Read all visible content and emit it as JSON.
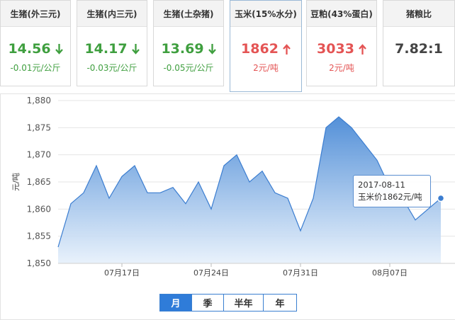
{
  "cards": [
    {
      "title": "生猪(外三元)",
      "price": "14.56",
      "direction": "down",
      "change": "-0.01元/公斤"
    },
    {
      "title": "生猪(内三元)",
      "price": "14.17",
      "direction": "down",
      "change": "-0.03元/公斤"
    },
    {
      "title": "生猪(土杂猪)",
      "price": "13.69",
      "direction": "down",
      "change": "-0.05元/公斤"
    },
    {
      "title": "玉米(15%水分)",
      "price": "1862",
      "direction": "up",
      "change": "2元/吨"
    },
    {
      "title": "豆粕(43%蛋白)",
      "price": "3033",
      "direction": "up",
      "change": "2元/吨"
    },
    {
      "title": "猪粮比",
      "price": "7.82:1",
      "direction": "none",
      "change": ""
    }
  ],
  "colors": {
    "down": "#3f9f3f",
    "up": "#e45454",
    "accent": "#2f7cd9",
    "area_top": "#4a8ad6",
    "area_bottom": "#e6f0fb"
  },
  "chart_data": {
    "type": "area",
    "ylabel": "元/吨",
    "ylim": [
      1850,
      1880
    ],
    "yticks": [
      1850,
      1855,
      1860,
      1865,
      1870,
      1875,
      1880
    ],
    "ytick_labels": [
      "1,850",
      "1,855",
      "1,860",
      "1,865",
      "1,870",
      "1,875",
      "1,880"
    ],
    "xticks": [
      {
        "date": "2017-07-17",
        "label": "07月17日"
      },
      {
        "date": "2017-07-24",
        "label": "07月24日"
      },
      {
        "date": "2017-07-31",
        "label": "07月31日"
      },
      {
        "date": "2017-08-07",
        "label": "08月07日"
      }
    ],
    "series": [
      {
        "name": "玉米价",
        "x": [
          "2017-07-12",
          "2017-07-13",
          "2017-07-14",
          "2017-07-15",
          "2017-07-16",
          "2017-07-17",
          "2017-07-18",
          "2017-07-19",
          "2017-07-20",
          "2017-07-21",
          "2017-07-22",
          "2017-07-23",
          "2017-07-24",
          "2017-07-25",
          "2017-07-26",
          "2017-07-27",
          "2017-07-28",
          "2017-07-29",
          "2017-07-30",
          "2017-07-31",
          "2017-08-01",
          "2017-08-02",
          "2017-08-03",
          "2017-08-04",
          "2017-08-05",
          "2017-08-06",
          "2017-08-07",
          "2017-08-08",
          "2017-08-09",
          "2017-08-10",
          "2017-08-11"
        ],
        "values": [
          1853,
          1861,
          1863,
          1868,
          1862,
          1866,
          1868,
          1863,
          1863,
          1864,
          1861,
          1865,
          1860,
          1868,
          1870,
          1865,
          1867,
          1863,
          1862,
          1856,
          1862,
          1875,
          1877,
          1875,
          1872,
          1869,
          1864,
          1862,
          1858,
          1860,
          1862
        ]
      }
    ]
  },
  "tooltip": {
    "date": "2017-08-11",
    "text": "玉米价1862元/吨"
  },
  "range_tabs": [
    {
      "label": "月",
      "active": true
    },
    {
      "label": "季",
      "active": false
    },
    {
      "label": "半年",
      "active": false
    },
    {
      "label": "年",
      "active": false
    }
  ]
}
